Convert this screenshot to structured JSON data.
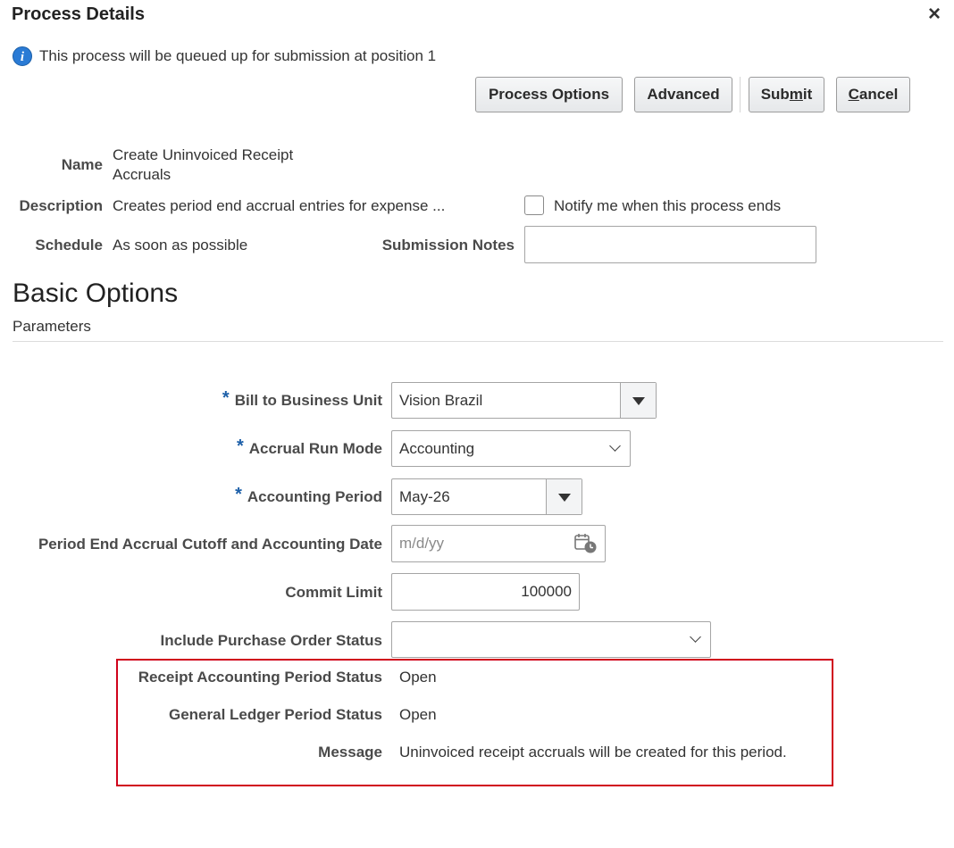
{
  "dialog": {
    "title": "Process Details",
    "close_label": "×",
    "info_message": "This process will be queued up for submission at position 1"
  },
  "toolbar": {
    "process_options": "Process Options",
    "advanced": "Advanced",
    "submit_pre": "Sub",
    "submit_u": "m",
    "submit_post": "it",
    "cancel_u": "C",
    "cancel_post": "ancel"
  },
  "details": {
    "name_label": "Name",
    "name_line1": "Create Uninvoiced Receipt",
    "name_line2": "Accruals",
    "description_label": "Description",
    "description_value": "Creates period end accrual entries for expense ...",
    "notify_label": "Notify me when this process ends",
    "notify_checked": false,
    "schedule_label": "Schedule",
    "schedule_value": "As soon as possible",
    "submission_notes_label": "Submission Notes",
    "submission_notes_value": ""
  },
  "basic_options": {
    "heading": "Basic Options",
    "subheading": "Parameters"
  },
  "parameters": {
    "required_marker": "*",
    "bill_to_bu_label": "Bill to Business Unit",
    "bill_to_bu_value": "Vision Brazil",
    "accrual_run_mode_label": "Accrual Run Mode",
    "accrual_run_mode_value": "Accounting",
    "accounting_period_label": "Accounting Period",
    "accounting_period_value": "May-26",
    "cutoff_date_label": "Period End Accrual Cutoff and Accounting Date",
    "cutoff_date_placeholder": "m/d/yy",
    "commit_limit_label": "Commit Limit",
    "commit_limit_value": "100000",
    "po_status_label": "Include Purchase Order Status",
    "po_status_value": "",
    "receipt_period_status_label": "Receipt Accounting Period Status",
    "receipt_period_status_value": "Open",
    "gl_period_status_label": "General Ledger Period Status",
    "gl_period_status_value": "Open",
    "message_label": "Message",
    "message_value": "Uninvoiced receipt accruals will be created for this period."
  },
  "colors": {
    "highlight_border": "#d0021b",
    "required_star": "#1c5fa8",
    "info_icon": "#2a7bd5"
  }
}
